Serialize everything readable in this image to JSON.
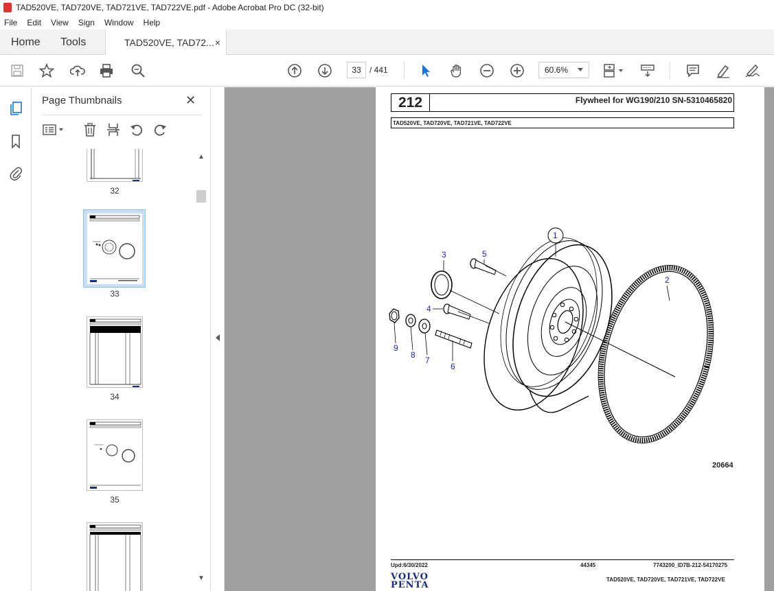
{
  "window": {
    "title": "TAD520VE, TAD720VE, TAD721VE, TAD722VE.pdf - Adobe Acrobat Pro DC (32-bit)"
  },
  "menu": [
    "File",
    "Edit",
    "View",
    "Sign",
    "Window",
    "Help"
  ],
  "tabs": {
    "home": "Home",
    "tools": "Tools",
    "document": "TAD520VE, TAD72...",
    "close": "×"
  },
  "toolbar": {
    "current_page": "33",
    "total_pages": "/ 441",
    "zoom": "60.6%",
    "icons": [
      "save-icon",
      "star-icon",
      "upload-icon",
      "print-icon",
      "zoom-search-icon",
      "page-up-icon",
      "page-down-icon",
      "select-cursor-icon",
      "hand-icon",
      "zoom-out-icon",
      "zoom-in-icon",
      "page-display-icon",
      "scroll-mode-icon",
      "comment-icon",
      "highlight-icon",
      "sign-icon"
    ]
  },
  "thumbnails_panel": {
    "title": "Page Thumbnails",
    "close": "✕",
    "pages": [
      {
        "label": "32",
        "selected": false
      },
      {
        "label": "33",
        "selected": true
      },
      {
        "label": "34",
        "selected": false
      },
      {
        "label": "35",
        "selected": false
      },
      {
        "label": "",
        "selected": false
      }
    ]
  },
  "document_page": {
    "section_number": "212",
    "title": "Flywheel for WG190/210 SN-5310465820",
    "models": "TAD520VE, TAD720VE, TAD721VE, TAD722VE",
    "callouts": [
      "1",
      "2",
      "3",
      "4",
      "5",
      "6",
      "7",
      "8",
      "9"
    ],
    "figure_number": "20664",
    "footer": {
      "updated": "Upd:6/30/2022",
      "code": "44345",
      "id": "7743200_ID7B-212-54170275",
      "models": "TAD520VE, TAD720VE, TAD721VE, TAD722VE",
      "logo_line1": "VOLVO",
      "logo_line2": "PENTA"
    }
  }
}
